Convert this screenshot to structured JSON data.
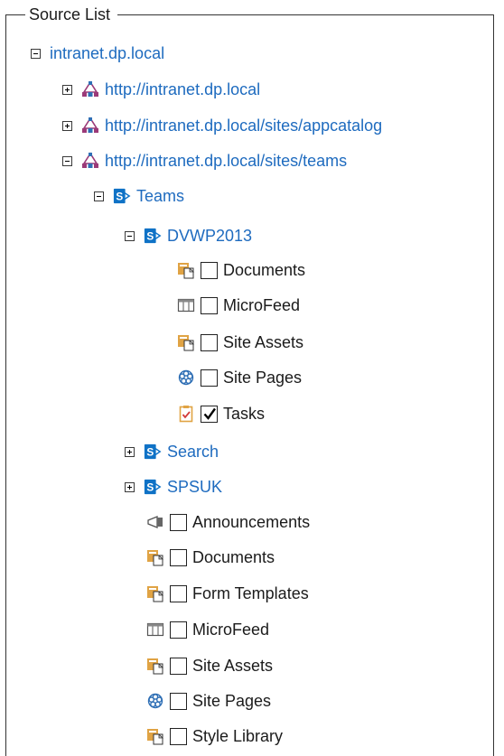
{
  "legend": "Source List",
  "tree": {
    "root": {
      "label": "intranet.dp.local",
      "state": "expanded"
    },
    "web_apps": [
      {
        "label": "http://intranet.dp.local",
        "state": "collapsed"
      },
      {
        "label": "http://intranet.dp.local/sites/appcatalog",
        "state": "collapsed"
      },
      {
        "label": "http://intranet.dp.local/sites/teams",
        "state": "expanded"
      }
    ],
    "sites": {
      "teams": {
        "label": "Teams",
        "state": "expanded"
      },
      "dvwp2013": {
        "label": "DVWP2013",
        "state": "expanded"
      },
      "search": {
        "label": "Search",
        "state": "collapsed"
      },
      "spsuk": {
        "label": "SPSUK",
        "state": "expanded"
      }
    },
    "dvwp_lists": [
      {
        "label": "Documents",
        "icon": "document-library-icon",
        "checked": false
      },
      {
        "label": "MicroFeed",
        "icon": "list-icon",
        "checked": false
      },
      {
        "label": "Site Assets",
        "icon": "document-library-icon",
        "checked": false
      },
      {
        "label": "Site Pages",
        "icon": "wiki-pages-icon",
        "checked": false
      },
      {
        "label": "Tasks",
        "icon": "tasks-icon",
        "checked": true
      }
    ],
    "spsuk_lists": [
      {
        "label": "Announcements",
        "icon": "announcements-icon",
        "checked": false
      },
      {
        "label": "Documents",
        "icon": "document-library-icon",
        "checked": false
      },
      {
        "label": "Form Templates",
        "icon": "document-library-icon",
        "checked": false
      },
      {
        "label": "MicroFeed",
        "icon": "list-icon",
        "checked": false
      },
      {
        "label": "Site Assets",
        "icon": "document-library-icon",
        "checked": false
      },
      {
        "label": "Site Pages",
        "icon": "wiki-pages-icon",
        "checked": false
      },
      {
        "label": "Style Library",
        "icon": "document-library-icon",
        "checked": false
      }
    ]
  },
  "colors": {
    "link": "#1e6bbf",
    "sharepoint_blue": "#0f72c6",
    "library_orange": "#e0a344",
    "text": "#1b1b1b",
    "border": "#333333"
  }
}
